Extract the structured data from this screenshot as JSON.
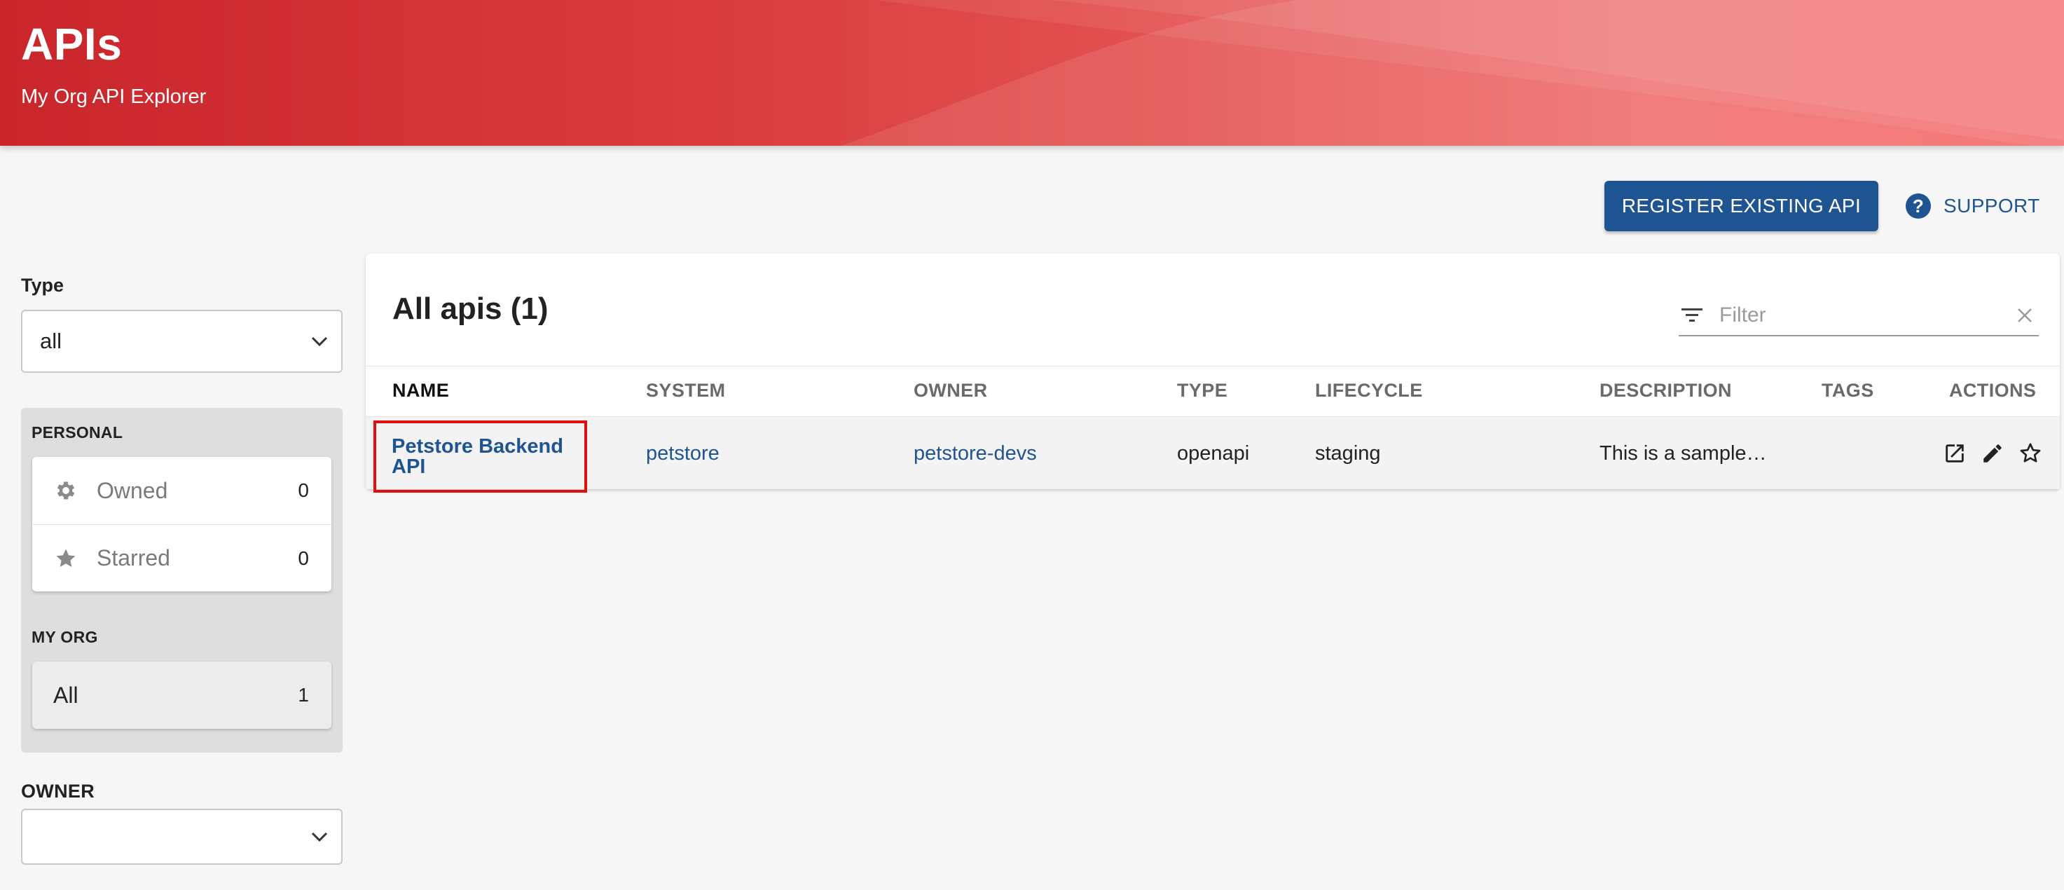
{
  "header": {
    "title": "APIs",
    "subtitle": "My Org API Explorer"
  },
  "toolbar": {
    "register_label": "REGISTER EXISTING API",
    "support_label": "SUPPORT"
  },
  "sidebar": {
    "type_label": "Type",
    "type_value": "all",
    "personal_heading": "PERSONAL",
    "personal_items": [
      {
        "label": "Owned",
        "count": "0",
        "icon": "gear-icon"
      },
      {
        "label": "Starred",
        "count": "0",
        "icon": "star-icon"
      }
    ],
    "org_heading": "MY ORG",
    "org_all_label": "All",
    "org_all_count": "1",
    "owner_label": "OWNER",
    "owner_value": ""
  },
  "table": {
    "title": "All apis (1)",
    "filter_placeholder": "Filter",
    "columns": [
      "NAME",
      "SYSTEM",
      "OWNER",
      "TYPE",
      "LIFECYCLE",
      "DESCRIPTION",
      "TAGS",
      "ACTIONS"
    ],
    "rows": [
      {
        "name": "Petstore Backend API",
        "system": "petstore",
        "owner": "petstore-devs",
        "type": "openapi",
        "lifecycle": "staging",
        "description": "This is a sample…",
        "tags": ""
      }
    ]
  },
  "colors": {
    "header_start": "#c9262c",
    "header_end": "#f46a6a",
    "primary": "#1f5493",
    "highlight_border": "#e01010"
  }
}
